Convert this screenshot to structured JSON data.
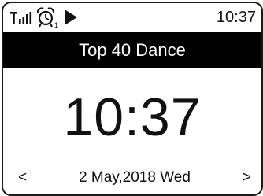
{
  "status": {
    "signal_icon": "signal-strength-icon",
    "alarm_icon": "alarm-clock-icon",
    "alarm_number": "1",
    "play_icon": "play-icon",
    "time": "10:37"
  },
  "station": {
    "name": "Top 40 Dance"
  },
  "clock": {
    "time": "10:37"
  },
  "date": {
    "prev": "<",
    "text": "2 May,2018 Wed",
    "next": ">"
  },
  "colors": {
    "banner_background": "#000000",
    "banner_text": "#ffffff",
    "foreground": "#111111",
    "background": "#ffffff"
  }
}
